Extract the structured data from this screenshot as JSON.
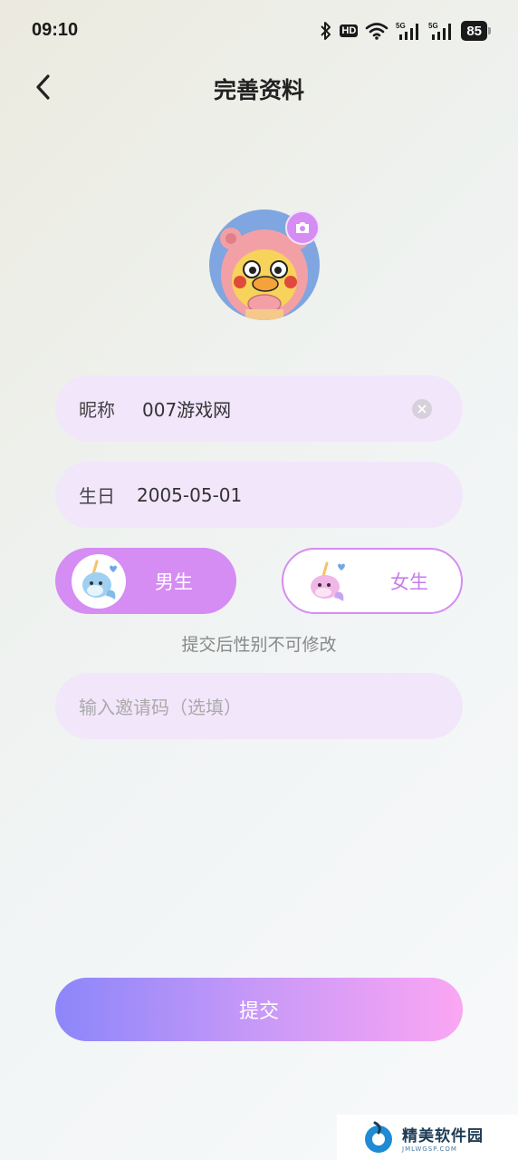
{
  "status_bar": {
    "time": "09:10",
    "battery": "85",
    "icons": [
      "bluetooth-icon",
      "hd-icon",
      "wifi-icon",
      "signal-5g-icon",
      "signal-5g-icon",
      "battery-icon"
    ],
    "hd_label": "HD",
    "net_label_1": "5G",
    "net_label_2": "5G"
  },
  "header": {
    "back_icon": "chevron-left-icon",
    "title": "完善资料"
  },
  "profile": {
    "camera_icon": "camera-icon"
  },
  "form": {
    "nickname_label": "昵称",
    "nickname_value": "007游戏网",
    "birthday_label": "生日",
    "birthday_value": "2005-05-01",
    "gender_male": "男生",
    "gender_female": "女生",
    "gender_selected": "male",
    "gender_hint": "提交后性别不可修改",
    "invite_placeholder": "输入邀请码（选填）"
  },
  "submit_label": "提交",
  "watermark": {
    "name": "精美软件园",
    "url": "JMLWGSP.COM"
  },
  "colors": {
    "accent": "#d58cf3",
    "field_bg": "#f2e6fb",
    "button_gradient_start": "#8c86fa",
    "button_gradient_end": "#fba6f3"
  }
}
